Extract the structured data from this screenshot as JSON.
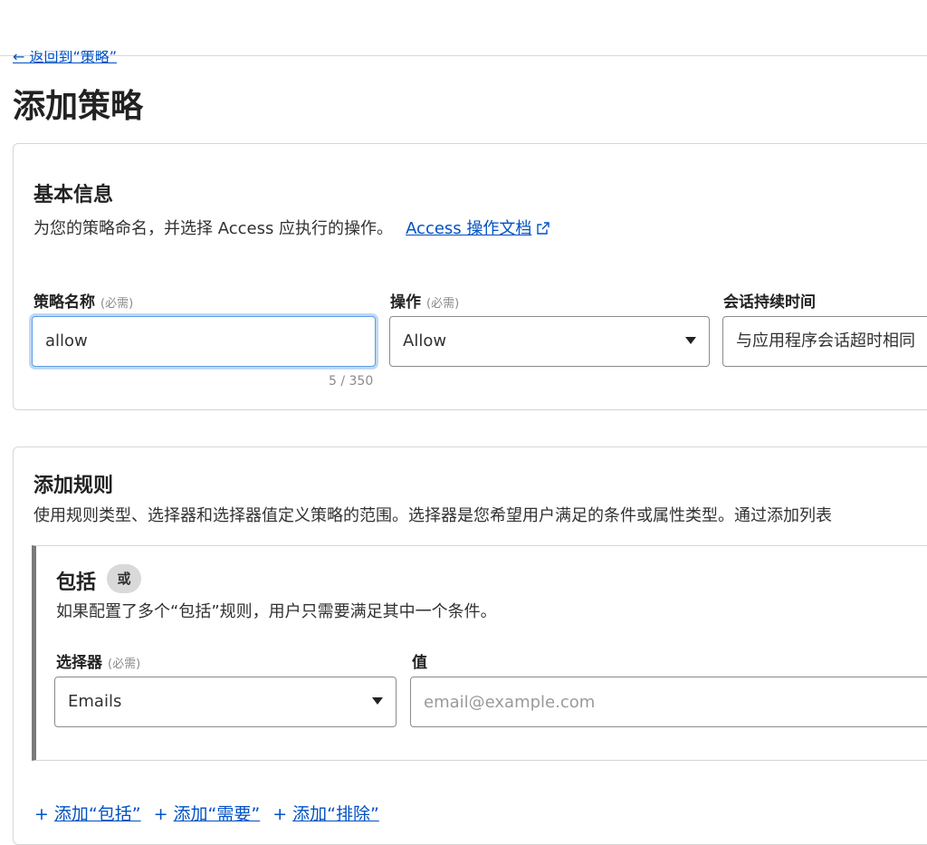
{
  "nav": {
    "back_label": "← 返回到“策略”"
  },
  "page": {
    "title": "添加策略"
  },
  "basic_info": {
    "title": "基本信息",
    "description": "为您的策略命名，并选择 Access 应执行的操作。",
    "doc_link": "Access 操作文档",
    "doc_link_icon": "external-link-icon",
    "policy_name": {
      "label": "策略名称",
      "required": "(必需)",
      "value": "allow",
      "counter": "5 / 350"
    },
    "action": {
      "label": "操作",
      "required": "(必需)",
      "value": "Allow"
    },
    "session_duration": {
      "label": "会话持续时间",
      "value": "与应用程序会话超时相同"
    }
  },
  "rules": {
    "title": "添加规则",
    "description": "使用规则类型、选择器和选择器值定义策略的范围。选择器是您希望用户满足的条件或属性类型。通过添加列表",
    "include": {
      "title": "包括",
      "badge": "或",
      "description": "如果配置了多个“包括”规则，用户只需要满足其中一个条件。",
      "selector": {
        "label": "选择器",
        "required": "(必需)",
        "value": "Emails"
      },
      "value_field": {
        "label": "值",
        "placeholder": "email@example.com"
      }
    },
    "actions": {
      "add_include": "添加“包括”",
      "add_require": "添加“需要”",
      "add_exclude": "添加“排除”"
    }
  },
  "colors": {
    "link": "#0051c3",
    "focus_ring": "#5a9de6",
    "border": "#d6d6d6"
  }
}
